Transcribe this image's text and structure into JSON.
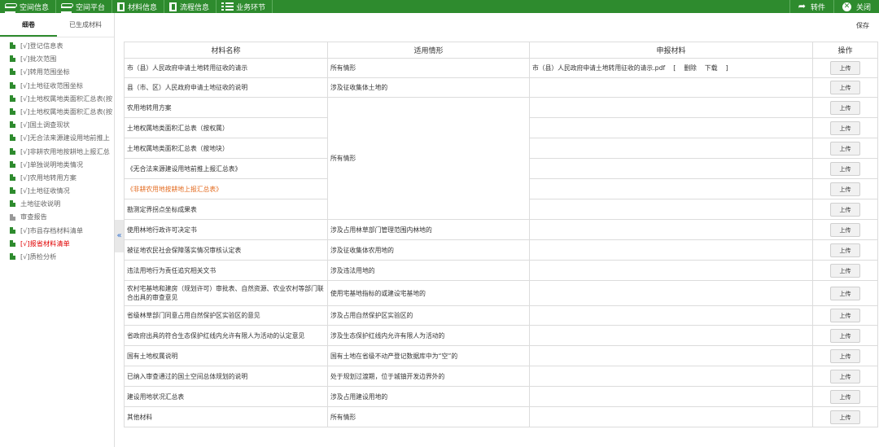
{
  "topbar": {
    "left": [
      {
        "label": "空间信息",
        "icon": "database-icon"
      },
      {
        "label": "空间平台",
        "icon": "database-icon"
      },
      {
        "label": "材料信息",
        "icon": "document-icon"
      },
      {
        "label": "流程信息",
        "icon": "document-icon"
      },
      {
        "label": "业务环节",
        "icon": "list-icon"
      }
    ],
    "forward": "转件",
    "close": "关闭"
  },
  "sidebar": {
    "tabs": [
      "细卷",
      "已生成材料"
    ],
    "items": [
      {
        "label": "[√]登记信息表",
        "color": "normal"
      },
      {
        "label": "[√]批次范围",
        "color": "normal"
      },
      {
        "label": "[√]转用范围坐标",
        "color": "normal"
      },
      {
        "label": "[√]土地征收范围坐标",
        "color": "normal"
      },
      {
        "label": "[√]土地权属地类面积汇总表(按",
        "color": "normal"
      },
      {
        "label": "[√]土地权属地类面积汇总表(按",
        "color": "normal"
      },
      {
        "label": "[√]国土调查现状",
        "color": "normal"
      },
      {
        "label": "[√]无合法来源建设用地前推上",
        "color": "normal"
      },
      {
        "label": "[√]非耕农用地按耕地上报汇总",
        "color": "normal"
      },
      {
        "label": "[√]单独说明地类情况",
        "color": "normal"
      },
      {
        "label": "[√]农用地转用方案",
        "color": "normal"
      },
      {
        "label": "[√]土地征收情况",
        "color": "normal"
      },
      {
        "label": "土地征收说明",
        "color": "normal"
      },
      {
        "label": "审查报告",
        "color": "grey"
      },
      {
        "label": "[√]市县存档材料清单",
        "color": "normal"
      },
      {
        "label": "[√]报省材料清单",
        "color": "red"
      },
      {
        "label": "[√]质检分析",
        "color": "normal"
      }
    ],
    "collapse_glyph": "«"
  },
  "main": {
    "save": "保存",
    "headers": [
      "材料名称",
      "适用情形",
      "申报材料",
      "操作"
    ],
    "upload_label": "上传",
    "file_actions": [
      "[",
      "删除",
      "下载",
      "]"
    ],
    "rows": [
      {
        "name": "市（县）人民政府申请土地转用征收的请示",
        "scope": "所有情形",
        "file": "市（县）人民政府申请土地转用征收的请示.pdf"
      },
      {
        "name": "县（市、区）人民政府申请土地征收的说明",
        "scope": "涉及征收集体土地的",
        "file": ""
      },
      {
        "name": "农用地转用方案",
        "scope": "所有情形",
        "file": ""
      },
      {
        "name": "土地权属地类面积汇总表（按权属）",
        "file": ""
      },
      {
        "name": "土地权属地类面积汇总表（按地块）",
        "file": ""
      },
      {
        "name": "《无合法来源建设用地前推上报汇总表》",
        "file": ""
      },
      {
        "name": "《非耕农用地按耕地上报汇总表》",
        "file": "",
        "orange": true
      },
      {
        "name": "勘测定界拐点坐标成果表",
        "file": ""
      },
      {
        "name": "使用林地行政许可决定书",
        "scope": "涉及占用林草部门管理范围内林地的",
        "file": ""
      },
      {
        "name": "被征地农民社会保障落实情况审核认定表",
        "scope": "涉及征收集体农用地的",
        "file": ""
      },
      {
        "name": "违法用地行为责任追究相关文书",
        "scope": "涉及违法用地的",
        "file": ""
      },
      {
        "name": "农村宅基地和建房（规划许可）审批表、自然资源、农业农村等部门联合出具的审查意见",
        "scope": "使用宅基地指标的或建设宅基地的",
        "file": ""
      },
      {
        "name": "省级林草部门同意占用自然保护区实验区的意见",
        "scope": "涉及占用自然保护区实验区的",
        "file": ""
      },
      {
        "name": "省政府出具的符合生态保护红线内允许有限人为活动的认定意见",
        "scope": "涉及生态保护红线内允许有限人为活动的",
        "file": ""
      },
      {
        "name": "国有土地权属说明",
        "scope": "国有土地在省级不动产登记数据库中为“空”的",
        "file": ""
      },
      {
        "name": "已纳入审查通过的国土空间总体规划的说明",
        "scope": "处于规划过渡期，位于城镇开发边界外的",
        "file": ""
      },
      {
        "name": "建设用地状况汇总表",
        "scope": "涉及占用建设用地的",
        "file": ""
      },
      {
        "name": "其他材料",
        "scope": "所有情形",
        "file": ""
      }
    ]
  }
}
